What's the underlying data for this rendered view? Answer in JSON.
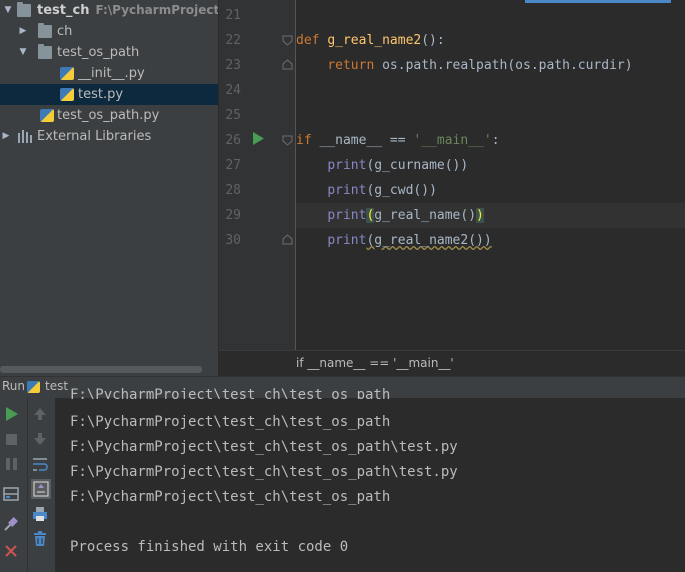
{
  "project_tree": {
    "items": [
      {
        "label": "test_ch",
        "path": "F:\\PycharmProject\\test_"
      },
      {
        "label": "ch"
      },
      {
        "label": "test_os_path"
      },
      {
        "label": "__init__.py"
      },
      {
        "label": "test.py"
      },
      {
        "label": "test_os_path.py"
      },
      {
        "label": "External Libraries"
      }
    ]
  },
  "editor": {
    "line_numbers": [
      "21",
      "22",
      "23",
      "24",
      "25",
      "26",
      "27",
      "28",
      "29",
      "30"
    ],
    "code": {
      "def_kw": "def",
      "func_name": "g_real_name2",
      "def_tail": "():",
      "return_kw": "return",
      "return_expr": "os.path.realpath(os.path.curdir)",
      "if_kw": "if",
      "if_mid": "__name__ == ",
      "if_str": "'__main__'",
      "if_colon": ":",
      "print_kw": "print",
      "call_27": "(g_curname())",
      "call_28": "(g_cwd())",
      "call_29_open": "(",
      "call_29_mid": "g_real_name()",
      "call_29_close": ")",
      "call_30": "(g_real_name2())"
    },
    "breadcrumb": "if __name__ == '__main__'"
  },
  "run_panel": {
    "label": "Run",
    "config_name": "test",
    "console_lines": [
      "F:\\PycharmProject\\test_ch\\test_os_path",
      "F:\\PycharmProject\\test_ch\\test_os_path\\test.py",
      "F:\\PycharmProject\\test_ch\\test_os_path\\test.py",
      "F:\\PycharmProject\\test_ch\\test_os_path",
      "",
      "Process finished with exit code 0"
    ]
  },
  "icons": {
    "tree": [
      "chevron-down-icon",
      "chevron-right-icon",
      "folder-icon",
      "python-file-icon",
      "libraries-icon"
    ],
    "toolbar": [
      "run-icon",
      "stop-icon",
      "pause-icon",
      "up-arrow-icon",
      "down-arrow-icon",
      "wrap-icon",
      "layout-icon",
      "scroll-icon",
      "print-icon",
      "pin-icon",
      "trash-icon",
      "close-icon"
    ]
  },
  "colors": {
    "keyword": "#cc7832",
    "function": "#ffc66d",
    "string": "#6a8759",
    "builtin": "#8888c6",
    "selection": "#0d293e",
    "accent": "#4a88c7",
    "run_green": "#499c54",
    "close_red": "#c75450"
  }
}
